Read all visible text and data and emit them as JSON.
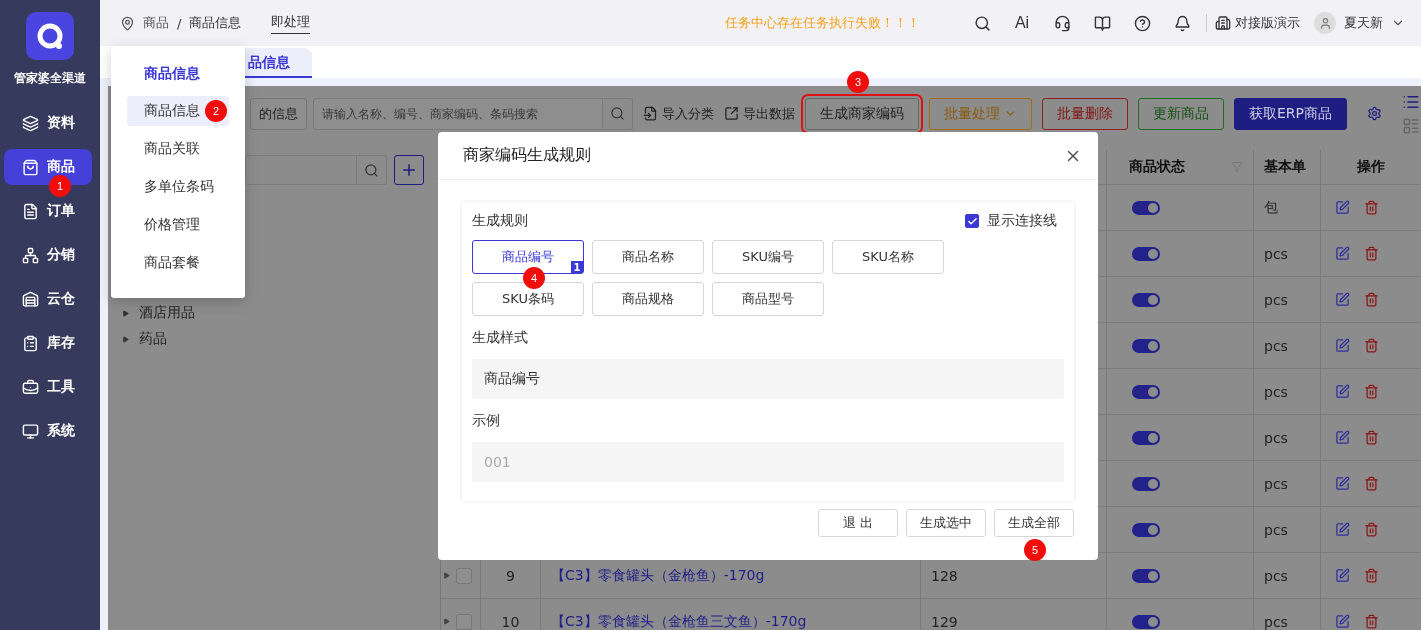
{
  "sidebar": {
    "brand": "管家婆全渠道",
    "items": [
      {
        "label": "资料",
        "selected": false
      },
      {
        "label": "商品",
        "selected": true,
        "step": "1"
      },
      {
        "label": "订单",
        "selected": false
      },
      {
        "label": "分销",
        "selected": false
      },
      {
        "label": "云仓",
        "selected": false
      },
      {
        "label": "库存",
        "selected": false
      },
      {
        "label": "工具",
        "selected": false
      },
      {
        "label": "系统",
        "selected": false
      }
    ]
  },
  "topbar": {
    "breadcrumb": [
      "商品",
      "商品信息"
    ],
    "separator": "/",
    "pending_link": "即处理",
    "alert": "任务中心存在任务执行失败！！！",
    "ai_label": "Ai",
    "company": "对接版演示",
    "user": "夏天新"
  },
  "tabs": [
    {
      "label": "品信息",
      "selected": true
    }
  ],
  "menu": {
    "heading": "商品信息",
    "items": [
      {
        "label": "商品信息",
        "selected": true,
        "step": "2"
      },
      {
        "label": "商品关联",
        "selected": false
      },
      {
        "label": "多单位条码",
        "selected": false
      },
      {
        "label": "价格管理",
        "selected": false
      },
      {
        "label": "商品套餐",
        "selected": false
      }
    ]
  },
  "toolbar": {
    "scope": "的信息",
    "search_placeholder": "请输入名称、编号、商家编码、条码搜索",
    "actions": [
      {
        "label": "导入分类",
        "kind": "import"
      },
      {
        "label": "导出数据",
        "kind": "export"
      }
    ],
    "buttons": [
      {
        "label": "生成商家编码",
        "kind": "default",
        "highlighted": true,
        "step": "3"
      },
      {
        "label": "批量处理",
        "kind": "warning",
        "dropdown": true
      },
      {
        "label": "批量删除",
        "kind": "danger"
      },
      {
        "label": "更新商品",
        "kind": "success"
      },
      {
        "label": "获取ERP商品",
        "kind": "primary"
      }
    ]
  },
  "category_tree": {
    "items": [
      {
        "label": "酒店用品",
        "expanded": false
      },
      {
        "label": "药品",
        "expanded": false
      }
    ]
  },
  "table": {
    "columns": [
      {
        "label": "商品状态",
        "filter": true
      },
      {
        "label": "基本单"
      },
      {
        "label": "操作"
      }
    ],
    "rows": [
      {
        "enabled": true,
        "unit": "包"
      },
      {
        "enabled": true,
        "unit": "pcs"
      },
      {
        "enabled": true,
        "unit": "pcs"
      },
      {
        "enabled": true,
        "unit": "pcs"
      },
      {
        "enabled": true,
        "unit": "pcs"
      },
      {
        "enabled": true,
        "unit": "pcs"
      },
      {
        "enabled": true,
        "unit": "pcs"
      },
      {
        "enabled": true,
        "unit": "pcs"
      },
      {
        "index": "9",
        "checked": false,
        "name": "【C3】零食罐头（金枪鱼）-170g",
        "code": "128",
        "enabled": true,
        "unit": "pcs"
      },
      {
        "index": "10",
        "checked": false,
        "name": "【C3】零食罐头（金枪鱼三文鱼）-170g",
        "code": "129",
        "enabled": true,
        "unit": "pcs"
      }
    ]
  },
  "dialog": {
    "title": "商家编码生成规则",
    "rule_label": "生成规则",
    "show_lines": {
      "label": "显示连接线",
      "checked": true
    },
    "fields": [
      {
        "label": "商品编号",
        "selected": true,
        "order": "1",
        "step": "4"
      },
      {
        "label": "商品名称",
        "selected": false
      },
      {
        "label": "SKU编号",
        "selected": false
      },
      {
        "label": "SKU名称",
        "selected": false
      },
      {
        "label": "SKU条码",
        "selected": false
      },
      {
        "label": "商品规格",
        "selected": false
      },
      {
        "label": "商品型号",
        "selected": false
      }
    ],
    "style_label": "生成样式",
    "style_value": "商品编号",
    "example_label": "示例",
    "example_value": "001",
    "buttons": [
      {
        "label": "退 出"
      },
      {
        "label": "生成选中"
      },
      {
        "label": "生成全部",
        "step": "5"
      }
    ]
  }
}
